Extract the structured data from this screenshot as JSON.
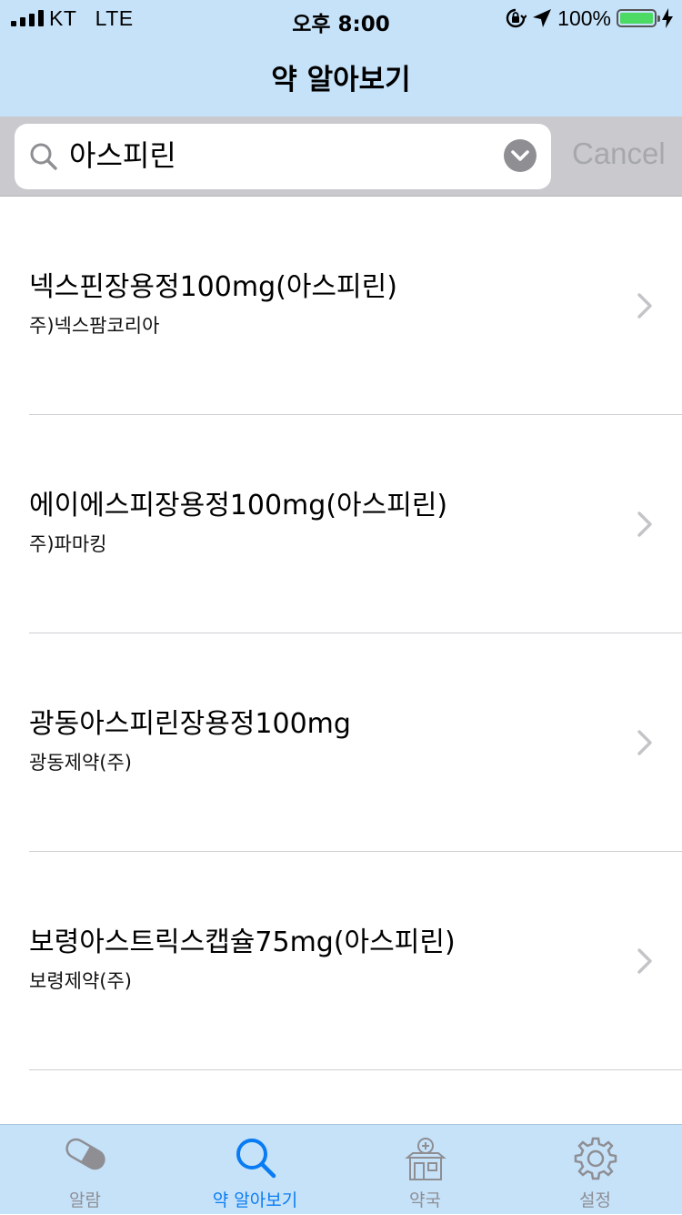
{
  "status": {
    "carrier": "KT   LTE",
    "time": "오후 8:00",
    "battery": "100%"
  },
  "nav": {
    "title": "약 알아보기"
  },
  "search": {
    "query": "아스피린",
    "cancel": "Cancel"
  },
  "results": [
    {
      "name": "넥스핀장용정100mg(아스피린)",
      "maker": "주)넥스팜코리아"
    },
    {
      "name": "에이에스피장용정100mg(아스피린)",
      "maker": "주)파마킹"
    },
    {
      "name": "광동아스피린장용정100mg",
      "maker": "광동제약(주)"
    },
    {
      "name": "보령아스트릭스캡슐75mg(아스피린)",
      "maker": "보령제약(주)"
    }
  ],
  "tabs": [
    {
      "label": "알람",
      "icon": "pill-icon"
    },
    {
      "label": "약 알아보기",
      "icon": "search-icon"
    },
    {
      "label": "약국",
      "icon": "pharmacy-icon"
    },
    {
      "label": "설정",
      "icon": "gear-icon"
    }
  ],
  "active_tab": "약 알아보기",
  "colors": {
    "bar": "#c6e2f9",
    "accent": "#0a7cf3",
    "inactive": "#8e8e93",
    "battery": "#4cd964"
  }
}
